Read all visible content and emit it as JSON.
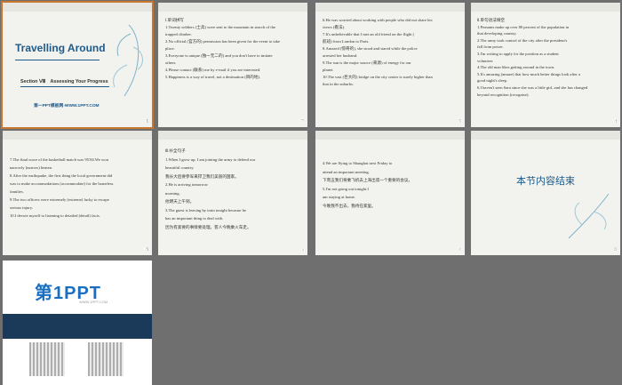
{
  "slides": [
    {
      "num": "1",
      "title": "Travelling Around",
      "subtitle": "Section Ⅷ　Assessing Your Progress",
      "link": "第一PPT模板网-WWW.1PPT.COM"
    },
    {
      "num": "2",
      "lines": [
        "Ⅰ.单词拼写",
        "1.Twenty soldiers (士兵) were sent to the mountain in search of the",
        "trapped climber.",
        "2.No official (官方的) permission has been given for the event to take",
        "place.",
        "3.Everyone is unique (独一无二的) and you don't have to imitate",
        "others.",
        "4.Please contact (联系) me by e-mail if you are interested.",
        "5.Happiness is a way of travel, not a destination (目的地)."
      ]
    },
    {
      "num": "3",
      "lines": [
        "6.He was worried about working with people who did not share his",
        "views (看法).",
        "7.It's unbelievable that I met an old friend on the flight (",
        "航班) from London to Paris.",
        "8.Amazed (惊奇的), she stood and stared while the police",
        "arrested her husband.",
        "9.The sun is the major source (来源) of energy for our",
        "planet.",
        "10.The vast (巨大的) bridge on the city center is surely higher than",
        "that in the suburbs."
      ]
    },
    {
      "num": "4",
      "lines": [
        "Ⅱ.单句语法填空",
        "1.Peasants make up over 80 percent of the population in",
        "that developing country.",
        "2.The army took control of the city after the president's",
        "fall from power.",
        "3.I'm writing to apply for the position as a student",
        "volunteer.",
        "4.The old man likes getting around in the town.",
        "5.It's amazing (amaze) that how much better things look after a",
        "good night's sleep.",
        "6.I haven't seen Sara since she was a little girl, and she has changed",
        "beyond recognition (recognise)."
      ]
    },
    {
      "num": "5",
      "lines": [
        "7.The final score of the basketball match was 95∶94.We won",
        "narrowly (narrow) beaten.",
        "8.After the earthquake, the first thing the local government did",
        "was to make accommodations (accommodate) for the homeless",
        "families.",
        "9.The two officers were extremely (extreme) lucky to escape",
        "serious injury.",
        "10.I devote myself to listening to detailed (detail) facts."
      ]
    },
    {
      "num": "6",
      "lines": [
        "Ⅲ.补全句子",
        "1.When I grow up, I am joining the army to defend our",
        "beautiful country.",
        "我长大后要参军来捍卫我们美丽的国家。",
        "2.He is arriving tomorrow",
        "morning.",
        "他明天上午到。",
        "3.The guest is leaving by train tonight because he",
        "has an important thing to deal with.",
        "因为有紧要的事情要处理，客人今晚乘火车走。"
      ]
    },
    {
      "num": "7",
      "lines": [
        "4.We are flying to Shanghai next Friday to",
        "attend an important meeting.",
        "下周五我们将乘飞机去上海出席一个重要的会议。",
        "5.I'm not going out tonight.I",
        "am staying at home.",
        "今晚我不出去，我待在家里。"
      ]
    },
    {
      "num": "8",
      "end": "本节内容结束"
    },
    {
      "num": "9",
      "brand": "第1PPT",
      "tagline": "WWW.1PPT.COM"
    }
  ],
  "colors": {
    "answer": "#c0272d",
    "title": "#1e5a8a",
    "bg": "#6f6f6f",
    "selected": "#c8772e"
  }
}
